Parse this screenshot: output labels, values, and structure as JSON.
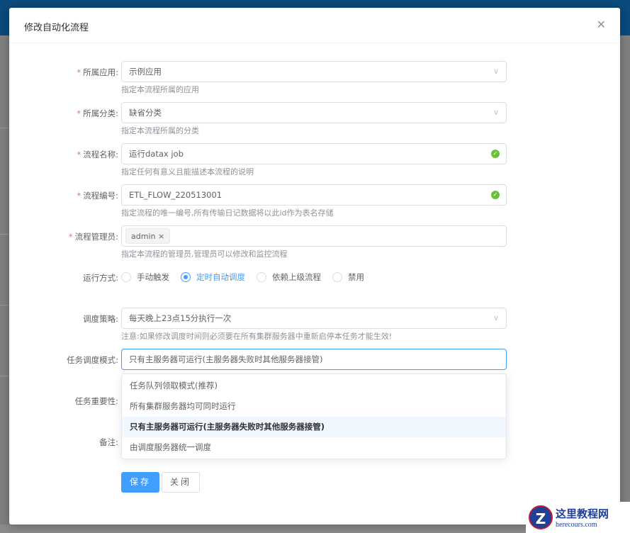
{
  "dialog": {
    "title": "修改自动化流程",
    "close_icon": "close-icon"
  },
  "form": {
    "app": {
      "label": "所属应用:",
      "value": "示例应用",
      "help": "指定本流程所属的应用"
    },
    "category": {
      "label": "所属分类:",
      "value": "缺省分类",
      "help": "指定本流程所属的分类"
    },
    "name": {
      "label": "流程名称:",
      "value": "运行datax job",
      "help": "指定任何有意义且能描述本流程的说明"
    },
    "code": {
      "label": "流程编号:",
      "value": "ETL_FLOW_220513001",
      "help": "指定流程的唯一编号,所有传输日记数据将以此id作为表名存储"
    },
    "managers": {
      "label": "流程管理员:",
      "tags": [
        "admin"
      ],
      "help": "指定本流程的管理员,管理员可以修改和监控流程"
    },
    "run_mode": {
      "label": "运行方式:",
      "options": [
        "手动触发",
        "定时自动调度",
        "依赖上级流程",
        "禁用"
      ],
      "selected": "定时自动调度"
    },
    "strategy": {
      "label": "调度策略:",
      "value": "每天晚上23点15分执行一次",
      "help": "注意:如果修改调度时间则必须要在所有集群服务器中重新启停本任务才能生效!"
    },
    "dispatch_mode": {
      "label": "任务调度模式:",
      "value": "只有主服务器可运行(主服务器失败时其他服务器接管)",
      "options": [
        "任务队列领取模式(推荐)",
        "所有集群服务器均可同时运行",
        "只有主服务器可运行(主服务器失败时其他服务器接管)",
        "由调度服务器统一调度"
      ]
    },
    "importance": {
      "label": "任务重要性:"
    },
    "remarks": {
      "label": "备注:"
    }
  },
  "buttons": {
    "save": "保存",
    "close": "关闭"
  },
  "watermark": {
    "title": "这里教程网",
    "url": "herecours.com"
  },
  "colors": {
    "primary": "#409eff",
    "success": "#67c23a",
    "required": "#f56c6c",
    "topbar": "#0a4a7c"
  }
}
